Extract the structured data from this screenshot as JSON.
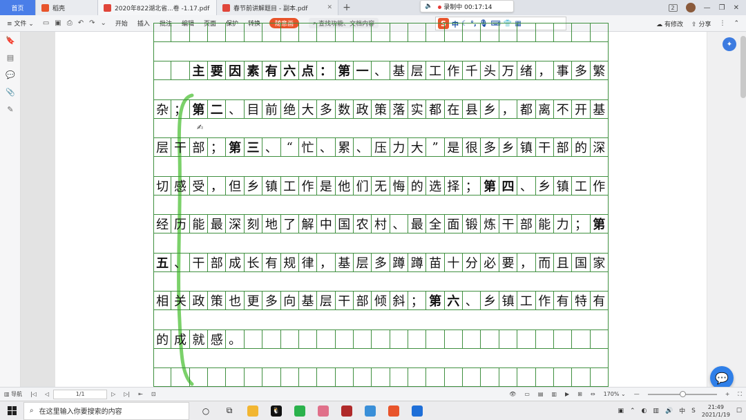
{
  "tabs": [
    {
      "label": "首页"
    },
    {
      "label": "稻壳"
    },
    {
      "label": "2020年822湖北省...卷 -1.17.pdf"
    },
    {
      "label": "春节前讲解题目 - 副本.pdf"
    }
  ],
  "recording": {
    "status": "录制中",
    "time": "00:17:14"
  },
  "badge_count": "2",
  "ribbon": {
    "file_menu": "文件",
    "tabs": [
      "开始",
      "插入",
      "批注",
      "编辑",
      "页面",
      "保护",
      "转换"
    ],
    "highlight": "随意画",
    "search_placeholder": "查找功能、文档内容",
    "modified": "有修改",
    "share": "分享"
  },
  "ime": {
    "logo": "S",
    "mode": "中"
  },
  "document": {
    "rows": [
      {
        "cells": [
          "",
          "",
          "主",
          "要",
          "因",
          "素",
          "有",
          "六",
          "点",
          "：",
          "第",
          "一",
          "、",
          "基",
          "层",
          "工",
          "作",
          "千",
          "头",
          "万",
          "绪",
          "，",
          "事",
          "多",
          "繁"
        ],
        "bold": [
          2,
          3,
          4,
          5,
          6,
          7,
          8,
          9,
          10,
          11
        ]
      },
      {
        "cells": [
          "杂",
          "；",
          "第",
          "二",
          "、",
          "目",
          "前",
          "绝",
          "大",
          "多",
          "数",
          "政",
          "策",
          "落",
          "实",
          "都",
          "在",
          "县",
          "乡",
          "，",
          "都",
          "离",
          "不",
          "开",
          "基"
        ],
        "bold": [
          2,
          3
        ]
      },
      {
        "cells": [
          "层",
          "干",
          "部",
          "；",
          "第",
          "三",
          "、",
          "“",
          "忙",
          "、",
          "累",
          "、",
          "压",
          "力",
          "大",
          "”",
          "是",
          "很",
          "多",
          "乡",
          "镇",
          "干",
          "部",
          "的",
          "深"
        ],
        "bold": [
          4,
          5
        ]
      },
      {
        "cells": [
          "切",
          "感",
          "受",
          "，",
          "但",
          "乡",
          "镇",
          "工",
          "作",
          "是",
          "他",
          "们",
          "无",
          "悔",
          "的",
          "选",
          "择",
          "；",
          "第",
          "四",
          "、",
          "乡",
          "镇",
          "工",
          "作"
        ],
        "bold": [
          18,
          19
        ]
      },
      {
        "cells": [
          "经",
          "历",
          "能",
          "最",
          "深",
          "刻",
          "地",
          "了",
          "解",
          "中",
          "国",
          "农",
          "村",
          "、",
          "最",
          "全",
          "面",
          "锻",
          "炼",
          "干",
          "部",
          "能",
          "力",
          "；",
          "第"
        ],
        "bold": [
          24
        ]
      },
      {
        "cells": [
          "五",
          "、",
          "干",
          "部",
          "成",
          "长",
          "有",
          "规",
          "律",
          "，",
          "基",
          "层",
          "多",
          "蹲",
          "蹲",
          "苗",
          "十",
          "分",
          "必",
          "要",
          "，",
          "而",
          "且",
          "国",
          "家"
        ],
        "bold": [
          0
        ]
      },
      {
        "cells": [
          "相",
          "关",
          "政",
          "策",
          "也",
          "更",
          "多",
          "向",
          "基",
          "层",
          "干",
          "部",
          "倾",
          "斜",
          "；",
          "第",
          "六",
          "、",
          "乡",
          "镇",
          "工",
          "作",
          "有",
          "特",
          "有"
        ],
        "bold": [
          15,
          16
        ]
      },
      {
        "cells": [
          "的",
          "成",
          "就",
          "感",
          "。",
          "",
          "",
          "",
          "",
          "",
          "",
          "",
          "",
          "",
          "",
          "",
          "",
          "",
          "",
          "",
          "",
          "",
          "",
          "",
          ""
        ],
        "bold": []
      }
    ],
    "bracket_color": "#7bd16a"
  },
  "statusbar": {
    "nav": "导航",
    "page": "1/1",
    "zoom": "170%"
  },
  "taskbar": {
    "search_placeholder": "在这里输入你要搜索的内容",
    "time": "21:49",
    "date": "2021/1/19"
  }
}
